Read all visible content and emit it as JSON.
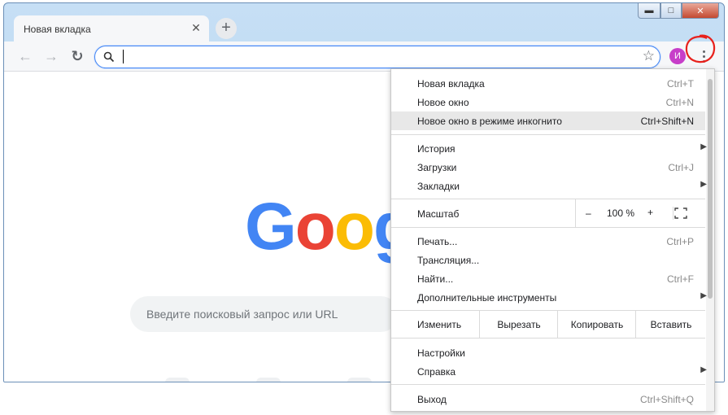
{
  "tab": {
    "title": "Новая вкладка",
    "close": "✕"
  },
  "newtab": {
    "label": "+"
  },
  "toolbar": {
    "back": "←",
    "forward": "→",
    "reload": "↻",
    "omnibox_value": "",
    "star": "☆",
    "avatar_initial": "И"
  },
  "window_controls": {
    "minimize": "▬",
    "maximize": "□",
    "close": "✕"
  },
  "content": {
    "logo_letters": [
      {
        "ch": "G",
        "color": "#4285f4"
      },
      {
        "ch": "o",
        "color": "#ea4335"
      },
      {
        "ch": "o",
        "color": "#fbbc05"
      },
      {
        "ch": "g",
        "color": "#4285f4"
      }
    ],
    "search_placeholder": "Введите поисковый запрос или URL"
  },
  "menu": {
    "items_group1": [
      {
        "label": "Новая вкладка",
        "shortcut": "Ctrl+T"
      },
      {
        "label": "Новое окно",
        "shortcut": "Ctrl+N"
      },
      {
        "label": "Новое окно в режиме инкогнито",
        "shortcut": "Ctrl+Shift+N",
        "highlighted": true
      }
    ],
    "items_group2": [
      {
        "label": "История",
        "submenu": true
      },
      {
        "label": "Загрузки",
        "shortcut": "Ctrl+J"
      },
      {
        "label": "Закладки",
        "submenu": true
      }
    ],
    "zoom": {
      "label": "Масштаб",
      "minus": "–",
      "value": "100 %",
      "plus": "+"
    },
    "items_group3": [
      {
        "label": "Печать...",
        "shortcut": "Ctrl+P"
      },
      {
        "label": "Трансляция..."
      },
      {
        "label": "Найти...",
        "shortcut": "Ctrl+F"
      },
      {
        "label": "Дополнительные инструменты",
        "submenu": true
      }
    ],
    "edit": {
      "label": "Изменить",
      "cut": "Вырезать",
      "copy": "Копировать",
      "paste": "Вставить"
    },
    "items_group4": [
      {
        "label": "Настройки"
      },
      {
        "label": "Справка",
        "submenu": true
      }
    ],
    "exit": {
      "label": "Выход",
      "shortcut": "Ctrl+Shift+Q"
    }
  },
  "colors": {
    "accent": "#4285f4",
    "annotation": "#e8211c",
    "avatar": "#c73ec9"
  }
}
